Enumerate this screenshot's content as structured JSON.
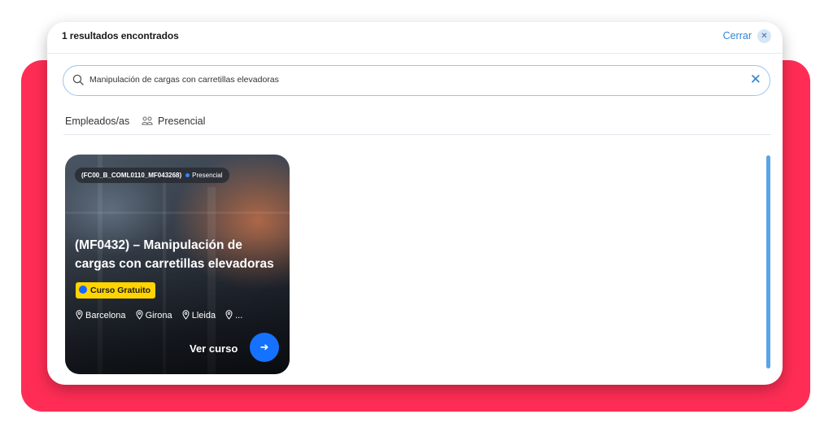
{
  "header": {
    "result_count": "1 resultados encontrados",
    "close_label": "Cerrar",
    "close_icon": "close-icon"
  },
  "search": {
    "value": "Manipulación de cargas con carretillas elevadoras",
    "search_icon": "search-icon",
    "clear_icon": "clear-icon"
  },
  "filters": [
    {
      "label": "Empleados/as",
      "icon": ""
    },
    {
      "label": "Presencial",
      "icon": "people-icon"
    }
  ],
  "results": [
    {
      "code": "(FC00_B_COML0110_MF043268)",
      "modality": "Presencial",
      "title": "(MF0432) – Manipulación de cargas con carretillas elevadoras",
      "badge": "Curso Gratuito",
      "locations": [
        "Barcelona",
        "Girona",
        "Lleida",
        "..."
      ],
      "cta_label": "Ver curso",
      "cta_icon": "arrow-right-icon"
    }
  ],
  "colors": {
    "accent_red": "#ff2d55",
    "link_blue": "#2f86d6",
    "cta_blue": "#1572ff",
    "badge_yellow": "#ffd400",
    "scrollbar": "#5aa4e8"
  }
}
